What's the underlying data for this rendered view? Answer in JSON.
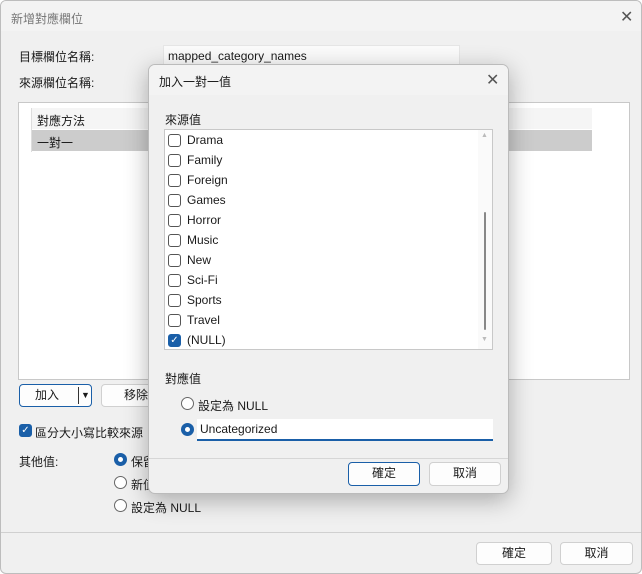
{
  "main": {
    "title": "新增對應欄位",
    "target_label": "目標欄位名稱:",
    "target_value": "mapped_category_names",
    "source_label": "來源欄位名稱:",
    "table": {
      "header": "對應方法",
      "rows": [
        "一對一"
      ]
    },
    "add_label": "加入",
    "remove_label": "移除",
    "case_label": "區分大小寫比較來源",
    "case_checked": true,
    "other_label": "其他值:",
    "other_options": [
      {
        "label": "保留",
        "selected": true
      },
      {
        "label": "新值",
        "selected": false
      },
      {
        "label": "設定為 NULL",
        "selected": false
      }
    ],
    "ok": "確定",
    "cancel": "取消"
  },
  "modal": {
    "title": "加入一對一值",
    "source_label": "來源值",
    "items": [
      {
        "label": "Drama",
        "checked": false
      },
      {
        "label": "Family",
        "checked": false
      },
      {
        "label": "Foreign",
        "checked": false
      },
      {
        "label": "Games",
        "checked": false
      },
      {
        "label": "Horror",
        "checked": false
      },
      {
        "label": "Music",
        "checked": false
      },
      {
        "label": "New",
        "checked": false
      },
      {
        "label": "Sci-Fi",
        "checked": false
      },
      {
        "label": "Sports",
        "checked": false
      },
      {
        "label": "Travel",
        "checked": false
      },
      {
        "label": "(NULL)",
        "checked": true
      }
    ],
    "map_label": "對應值",
    "opt_null": "設定為 NULL",
    "opt_value": "Uncategorized",
    "selected": "value",
    "ok": "確定",
    "cancel": "取消"
  },
  "colors": {
    "accent": "#1a5fa8"
  }
}
